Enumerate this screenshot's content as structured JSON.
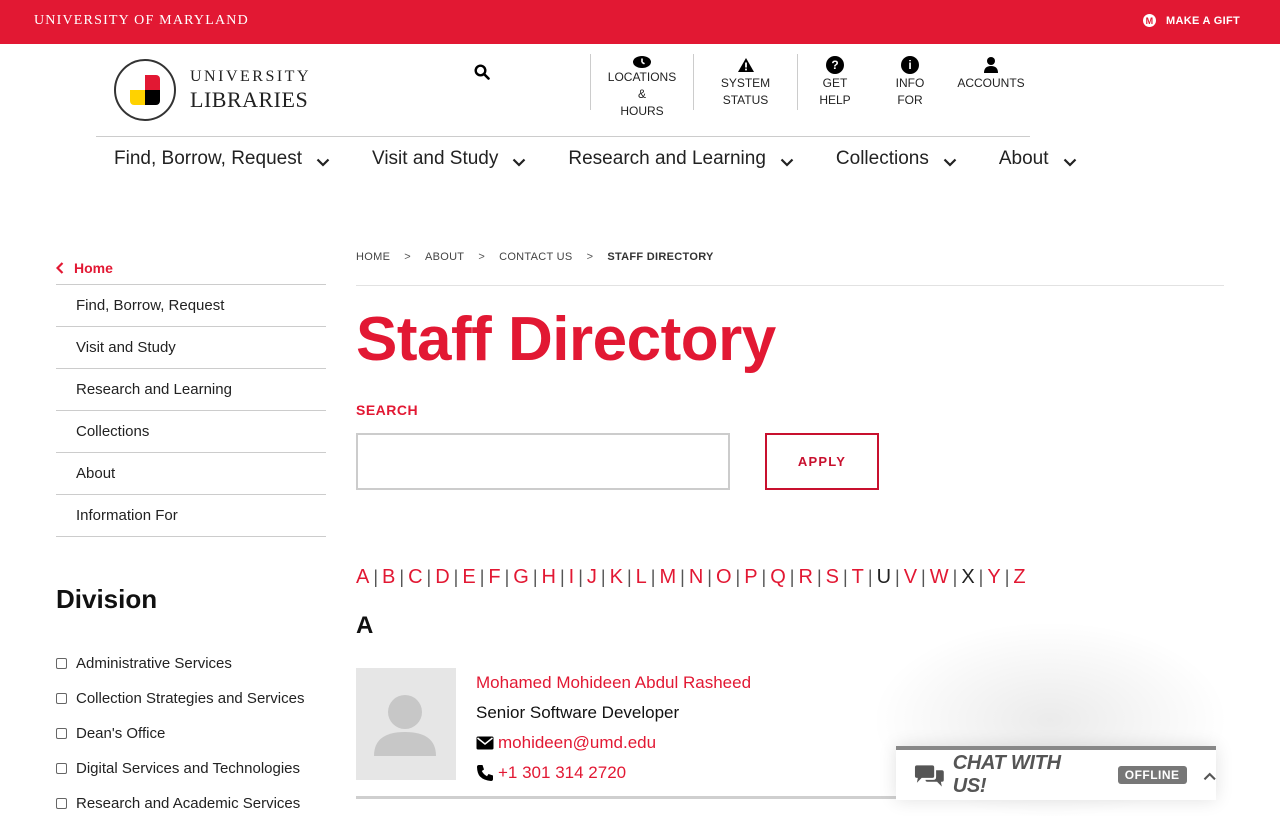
{
  "topbar": {
    "university": "UNIVERSITY OF MARYLAND",
    "gift_label": "MAKE A GIFT",
    "gift_icon": "M"
  },
  "logo": {
    "line1": "UNIVERSITY",
    "line2": "LIBRARIES",
    "seal_text": "UNIVERSITY OF MARYLAND"
  },
  "utility": [
    {
      "icon": "clock-icon",
      "label": "LOCATIONS &",
      "label2": "HOURS"
    },
    {
      "icon": "warning-icon",
      "label": "SYSTEM",
      "label2": "STATUS"
    },
    {
      "icon": "help-icon",
      "label": "GET HELP",
      "label2": ""
    },
    {
      "icon": "info-icon",
      "label": "INFO FOR",
      "label2": ""
    },
    {
      "icon": "user-icon",
      "label": "ACCOUNTS",
      "label2": ""
    }
  ],
  "mainnav": [
    "Find, Borrow, Request",
    "Visit and Study",
    "Research and Learning",
    "Collections",
    "About"
  ],
  "sidebar": {
    "home": "Home",
    "items": [
      "Find, Borrow, Request",
      "Visit and Study",
      "Research and Learning",
      "Collections",
      "About",
      "Information For"
    ]
  },
  "division": {
    "title": "Division",
    "items": [
      "Administrative Services",
      "Collection Strategies and Services",
      "Dean's Office",
      "Digital Services and Technologies",
      "Research and Academic Services"
    ]
  },
  "breadcrumb": {
    "items": [
      "HOME",
      "ABOUT",
      "CONTACT US"
    ],
    "current": "STAFF DIRECTORY",
    "separator": ">"
  },
  "page": {
    "title": "Staff Directory",
    "search_label": "SEARCH",
    "search_value": "",
    "apply_label": "APPLY"
  },
  "alphabet": {
    "letters": [
      "A",
      "B",
      "C",
      "D",
      "E",
      "F",
      "G",
      "H",
      "I",
      "J",
      "K",
      "L",
      "M",
      "N",
      "O",
      "P",
      "Q",
      "R",
      "S",
      "T",
      "U",
      "V",
      "W",
      "X",
      "Y",
      "Z"
    ],
    "inactive": [
      "U",
      "X"
    ],
    "current_heading": "A"
  },
  "staff": [
    {
      "name": "Mohamed Mohideen Abdul Rasheed",
      "title": "Senior Software Developer",
      "email": "mohideen@umd.edu",
      "phone": "+1 301 314 2720"
    }
  ],
  "chat": {
    "label": "CHAT WITH US!",
    "status": "OFFLINE"
  },
  "colors": {
    "brand_red": "#e21833",
    "text": "#222222",
    "rule": "#cccccc"
  }
}
